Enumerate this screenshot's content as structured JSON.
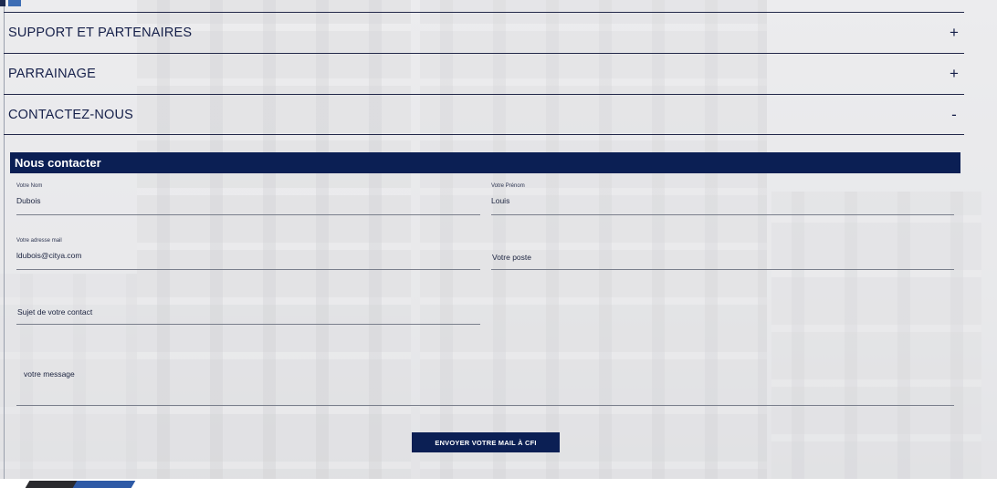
{
  "accordion": {
    "items": [
      {
        "title": "SUPPORT ET PARTENAIRES",
        "toggle": "+"
      },
      {
        "title": "PARRAINAGE",
        "toggle": "+"
      },
      {
        "title": "CONTACTEZ-NOUS",
        "toggle": "-"
      }
    ]
  },
  "contact_form": {
    "header": "Nous contacter",
    "nom": {
      "label": "Votre Nom",
      "value": "Dubois"
    },
    "prenom": {
      "label": "Votre Prénom",
      "value": "Louis"
    },
    "mail": {
      "label": "Votre adresse mail",
      "value": "ldubois@citya.com"
    },
    "poste": {
      "placeholder": "Votre poste"
    },
    "sujet": {
      "placeholder": "Sujet de votre contact"
    },
    "message": {
      "placeholder": "votre message"
    },
    "submit_label": "ENVOYER VOTRE MAIL À CFI"
  },
  "colors": {
    "navy": "#0b1f54",
    "accent_blue": "#2e5aa6"
  }
}
